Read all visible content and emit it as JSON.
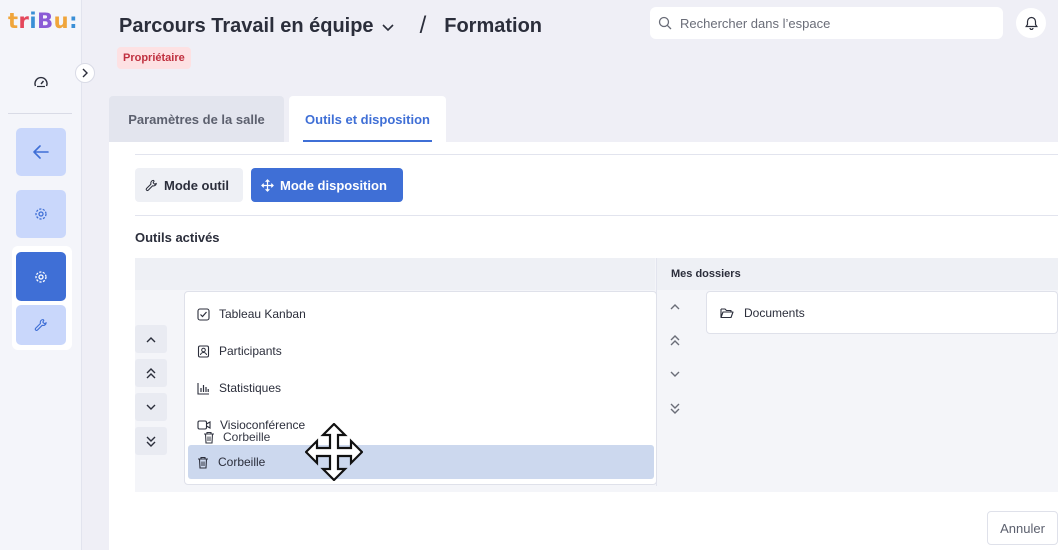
{
  "app": {
    "logo_text": "tribu:"
  },
  "header": {
    "space_title": "Parcours Travail en équipe",
    "separator": "/",
    "section": "Formation",
    "role_badge": "Propriétaire",
    "search_placeholder": "Rechercher dans l’espace"
  },
  "tabs": [
    {
      "label": "Paramètres de la salle",
      "active": false
    },
    {
      "label": "Outils et disposition",
      "active": true
    }
  ],
  "modes": {
    "tool_mode_label": "Mode outil",
    "layout_mode_label": "Mode disposition",
    "active": "layout"
  },
  "tools_section": {
    "title": "Outils activés",
    "items": [
      {
        "label": "Tableau Kanban",
        "icon": "checkbox-icon"
      },
      {
        "label": "Participants",
        "icon": "contact-icon"
      },
      {
        "label": "Statistiques",
        "icon": "bar-chart-icon"
      },
      {
        "label": "Visioconférence",
        "icon": "video-icon"
      }
    ],
    "dragging_item": {
      "label": "Corbeille",
      "icon": "trash-icon"
    },
    "drop_placeholder": {
      "label": "Corbeille",
      "icon": "trash-icon"
    }
  },
  "folders_section": {
    "title": "Mes dossiers",
    "items": [
      {
        "label": "Documents",
        "icon": "folder-open-icon"
      }
    ]
  },
  "footer": {
    "cancel_label": "Annuler"
  },
  "colors": {
    "accent": "#3f6fd6",
    "accent_light": "#c9d7fb",
    "badge_bg": "#fde1e3",
    "badge_text": "#c0303f",
    "drag_highlight": "#ccd8ee"
  }
}
